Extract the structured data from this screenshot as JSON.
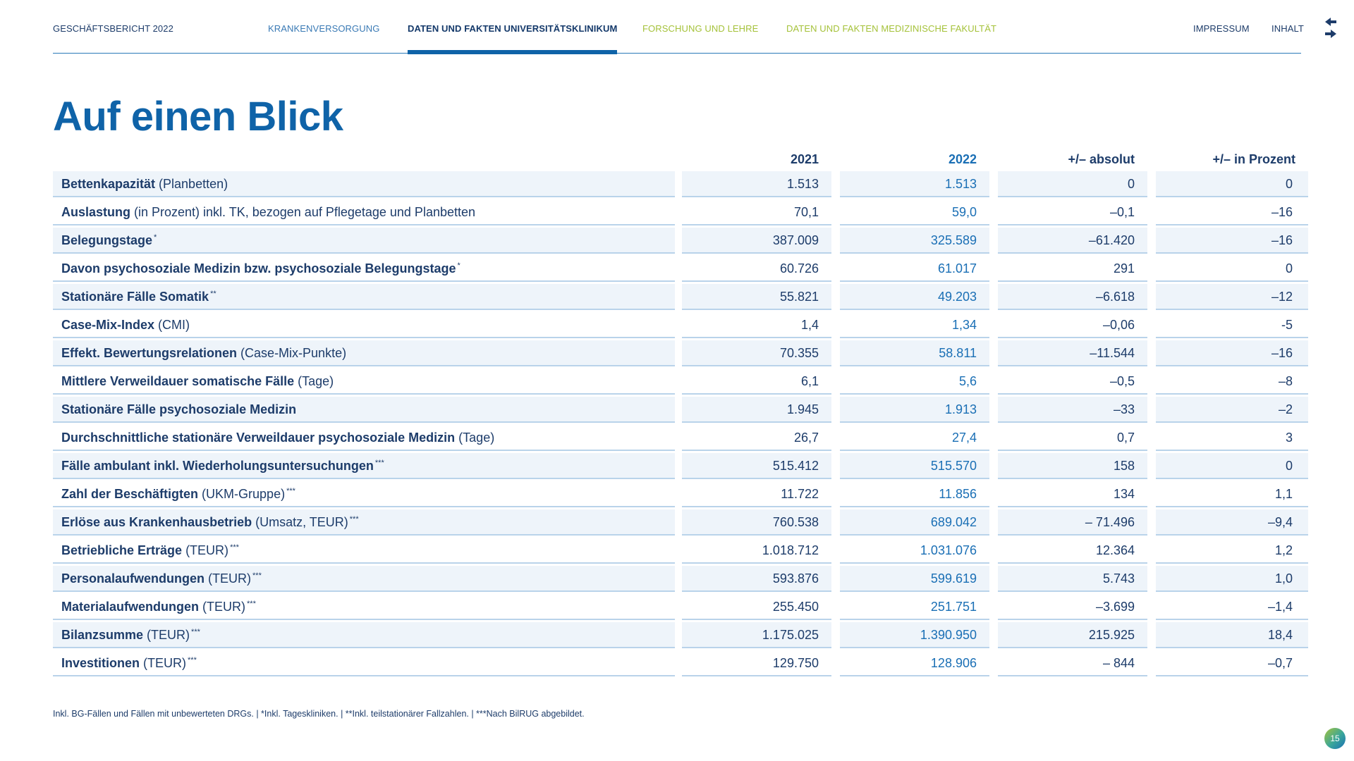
{
  "nav": {
    "report": "GESCHÄFTSBERICHT 2022",
    "items": [
      {
        "label": "KRANKENVERSORGUNG"
      },
      {
        "label": "DATEN UND FAKTEN UNIVERSITÄTSKLINIKUM"
      },
      {
        "label": "FORSCHUNG UND LEHRE"
      },
      {
        "label": "DATEN UND FAKTEN MEDIZINISCHE FAKULTÄT"
      }
    ],
    "impressum": "IMPRESSUM",
    "inhalt": "INHALT"
  },
  "page_title": "Auf einen Blick",
  "table": {
    "headers": [
      "2021",
      "2022",
      "+/– absolut",
      "+/– in Prozent"
    ],
    "rows": [
      {
        "main": "Bettenkapazität",
        "sub": " (Planbetten)",
        "sup": "",
        "v2021": "1.513",
        "v2022": "1.513",
        "abs": "0",
        "pct": "0"
      },
      {
        "main": "Auslastung",
        "sub": " (in Prozent) inkl. TK, bezogen auf Pflegetage und Planbetten",
        "sup": "",
        "v2021": "70,1",
        "v2022": "59,0",
        "abs": "–0,1",
        "pct": "–16"
      },
      {
        "main": "Belegungstage",
        "sub": "",
        "sup": "*",
        "v2021": "387.009",
        "v2022": "325.589",
        "abs": "–61.420",
        "pct": "–16"
      },
      {
        "main": "Davon psychosoziale Medizin bzw. psychosoziale Belegungstage",
        "sub": "",
        "sup": "*",
        "v2021": "60.726",
        "v2022": "61.017",
        "abs": "291",
        "pct": "0"
      },
      {
        "main": "Stationäre Fälle Somatik",
        "sub": "",
        "sup": "**",
        "v2021": "55.821",
        "v2022": "49.203",
        "abs": "–6.618",
        "pct": "–12"
      },
      {
        "main": "Case-Mix-Index",
        "sub": " (CMI)",
        "sup": "",
        "v2021": "1,4",
        "v2022": "1,34",
        "abs": "–0,06",
        "pct": "-5"
      },
      {
        "main": "Effekt. Bewertungsrelationen",
        "sub": " (Case-Mix-Punkte)",
        "sup": "",
        "v2021": "70.355",
        "v2022": "58.811",
        "abs": "–11.544",
        "pct": "–16"
      },
      {
        "main": "Mittlere Verweildauer somatische Fälle",
        "sub": " (Tage)",
        "sup": "",
        "v2021": "6,1",
        "v2022": "5,6",
        "abs": "–0,5",
        "pct": "–8"
      },
      {
        "main": "Stationäre Fälle psychosoziale Medizin",
        "sub": "",
        "sup": "",
        "v2021": "1.945",
        "v2022": "1.913",
        "abs": "–33",
        "pct": "–2"
      },
      {
        "main": "Durchschnittliche stationäre Verweildauer psychosoziale Medizin",
        "sub": " (Tage)",
        "sup": "",
        "v2021": "26,7",
        "v2022": "27,4",
        "abs": "0,7",
        "pct": "3"
      },
      {
        "main": "Fälle ambulant inkl. Wiederholungsuntersuchungen",
        "sub": "",
        "sup": "***",
        "v2021": "515.412",
        "v2022": "515.570",
        "abs": "158",
        "pct": "0"
      },
      {
        "main": "Zahl der Beschäftigten",
        "sub": " (UKM-Gruppe)",
        "sup": "***",
        "v2021": "11.722",
        "v2022": "11.856",
        "abs": "134",
        "pct": "1,1"
      },
      {
        "main": "Erlöse aus Krankenhausbetrieb",
        "sub": " (Umsatz, TEUR)",
        "sup": "***",
        "v2021": "760.538",
        "v2022": "689.042",
        "abs": "– 71.496",
        "pct": "–9,4"
      },
      {
        "main": "Betriebliche Erträge",
        "sub": " (TEUR)",
        "sup": "***",
        "v2021": "1.018.712",
        "v2022": "1.031.076",
        "abs": "12.364",
        "pct": "1,2"
      },
      {
        "main": "Personalaufwendungen",
        "sub": " (TEUR)",
        "sup": "***",
        "v2021": "593.876",
        "v2022": "599.619",
        "abs": "5.743",
        "pct": "1,0"
      },
      {
        "main": "Materialaufwendungen",
        "sub": " (TEUR)",
        "sup": "***",
        "v2021": "255.450",
        "v2022": "251.751",
        "abs": "–3.699",
        "pct": "–1,4"
      },
      {
        "main": "Bilanzsumme",
        "sub": " (TEUR)",
        "sup": "***",
        "v2021": "1.175.025",
        "v2022": "1.390.950",
        "abs": "215.925",
        "pct": "18,4"
      },
      {
        "main": "Investitionen",
        "sub": " (TEUR)",
        "sup": "***",
        "v2021": "129.750",
        "v2022": "128.906",
        "abs": "– 844",
        "pct": "–0,7"
      }
    ]
  },
  "footnote": "Inkl. BG-Fällen und Fällen mit unbewerteten DRGs. | *Inkl. Tageskliniken. | **Inkl. teilstationärer Fallzahlen. | ***Nach BilRUG abgebildet.",
  "page_number": "15",
  "colors": {
    "accent": "#0f63a8",
    "text": "#1d3c6a",
    "green": "#a5c23a",
    "row_shade": "#eef4fa"
  }
}
